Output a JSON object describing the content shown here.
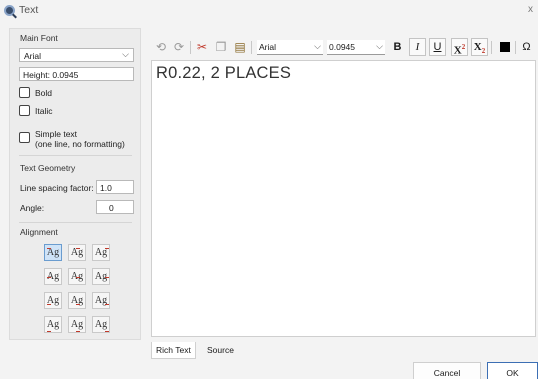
{
  "window": {
    "title": "Text",
    "close_glyph": "x"
  },
  "main_font": {
    "section_title": "Main Font",
    "font_family": "Arial",
    "height_label": "Height:",
    "height_value": "0.0945",
    "bold_label": "Bold",
    "bold_checked": false,
    "italic_label": "Italic",
    "italic_checked": false,
    "simple_text_line1": "Simple text",
    "simple_text_line2": "(one line, no formatting)",
    "simple_text_checked": false
  },
  "text_geometry": {
    "section_title": "Text Geometry",
    "line_spacing_label": "Line spacing factor:",
    "line_spacing_value": "1.0",
    "angle_label": "Angle:",
    "angle_value": "0"
  },
  "alignment": {
    "section_title": "Alignment",
    "glyph": "Ag",
    "selected": "top-left",
    "cells": [
      "top-left",
      "top-center",
      "top-right",
      "middle-left",
      "middle-center",
      "middle-right",
      "baseline-left",
      "baseline-center",
      "baseline-right",
      "bottom-left",
      "bottom-center",
      "bottom-right"
    ]
  },
  "toolbar": {
    "undo_icon": "undo-icon",
    "redo_icon": "redo-icon",
    "cut_icon": "cut-icon",
    "copy_icon": "copy-icon",
    "paste_icon": "paste-icon",
    "font_family": "Arial",
    "font_size": "0.0945",
    "bold": "B",
    "italic": "I",
    "underline": "U",
    "superscript_base": "X",
    "superscript_sup": "2",
    "subscript_base": "X",
    "subscript_sub": "2",
    "color_icon": "color-swatch-icon",
    "symbol": "Ω"
  },
  "editor": {
    "content": "R0.22, 2 PLACES"
  },
  "tabs": [
    {
      "label": "Rich Text",
      "active": true
    },
    {
      "label": "Source",
      "active": false
    }
  ],
  "buttons": {
    "cancel": "Cancel",
    "ok": "OK"
  },
  "colors": {
    "accent": "#3c6fb4",
    "selection": "#cfe3f7",
    "alignment_tick": "#c0392b",
    "cut_icon": "#c0392b"
  }
}
